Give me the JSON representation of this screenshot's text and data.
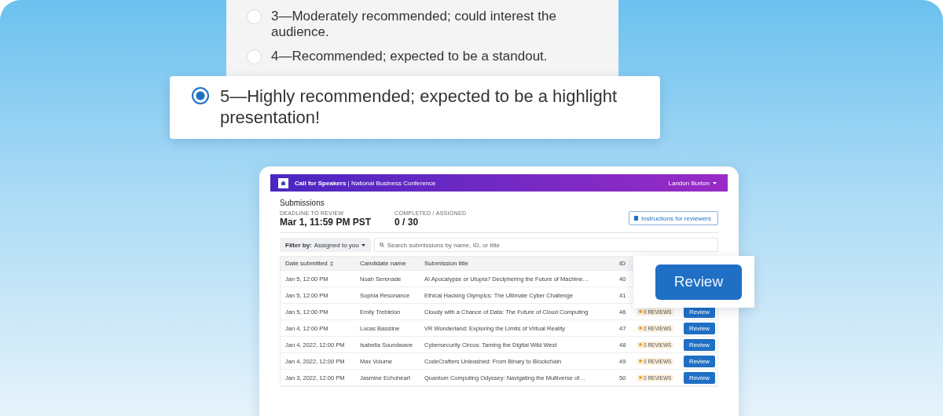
{
  "rating": {
    "options": [
      {
        "label": "3—Moderately recommended; could interest the audience.",
        "selected": false
      },
      {
        "label": "4—Recommended; expected to be a standout.",
        "selected": false
      },
      {
        "label": "5—Highly recommended; expected to be a highlight presentation!",
        "selected": true
      }
    ]
  },
  "app": {
    "header": {
      "title": "Call for Speakers",
      "subtitle": "National Business Conference",
      "separator": "|",
      "user": "Landon Burton"
    },
    "page_title": "Submissions",
    "stats": [
      {
        "label": "DEADLINE TO REVIEW",
        "value": "Mar 1, 11:59 PM PST"
      },
      {
        "label": "COMPLETED / ASSIGNED",
        "value": "0 / 30"
      }
    ],
    "instructions_button": "Instructions for reviewers",
    "filter": {
      "label": "Filter by:",
      "value": "Assigned to you"
    },
    "search": {
      "placeholder": "Search submissions by name, ID, or title"
    },
    "table": {
      "columns": [
        "Date submitted",
        "Candidate name",
        "Submission title",
        "ID"
      ],
      "rows": [
        {
          "date": "Jan 5, 12:00 PM",
          "name": "Noah Serenade",
          "title": "AI Apocalypse or Utopia? Deciphering the Future of Machine…",
          "id": "40"
        },
        {
          "date": "Jan 5, 12:00 PM",
          "name": "Sophia Resonance",
          "title": "Ethical Hacking Olympics: The Ultimate Cyber Challenge",
          "id": "41"
        },
        {
          "date": "Jan 5, 12:00 PM",
          "name": "Emily Treblelon",
          "title": "Cloudy with a Chance of Data: The Future of Cloud Computing",
          "id": "46",
          "status": "0 REVIEWS",
          "action": "Review"
        },
        {
          "date": "Jan 4, 12:00 PM",
          "name": "Lucas Bassline",
          "title": "VR Wonderland: Exploring the Limits of Virtual Reality",
          "id": "47",
          "status": "0 REVIEWS",
          "action": "Review"
        },
        {
          "date": "Jan 4, 2022, 12:00 PM",
          "name": "Isabella Soundwave",
          "title": "Cybersecurity Circus: Taming the Digital Wild West",
          "id": "48",
          "status": "0 REVIEWS",
          "action": "Review"
        },
        {
          "date": "Jan 4, 2022, 12:00 PM",
          "name": "Max Volume",
          "title": "CodeCrafters Unleashed: From Binary to Blockchain",
          "id": "49",
          "status": "0 REVIEWS",
          "action": "Review"
        },
        {
          "date": "Jan 3, 2022, 12:00 PM",
          "name": "Jasmine Echoheart",
          "title": "Quantum Computing Odyssey: Navigating the Multiverse of…",
          "id": "50",
          "status": "0 REVIEWS",
          "action": "Review"
        }
      ]
    }
  },
  "callout": {
    "button": "Review"
  }
}
